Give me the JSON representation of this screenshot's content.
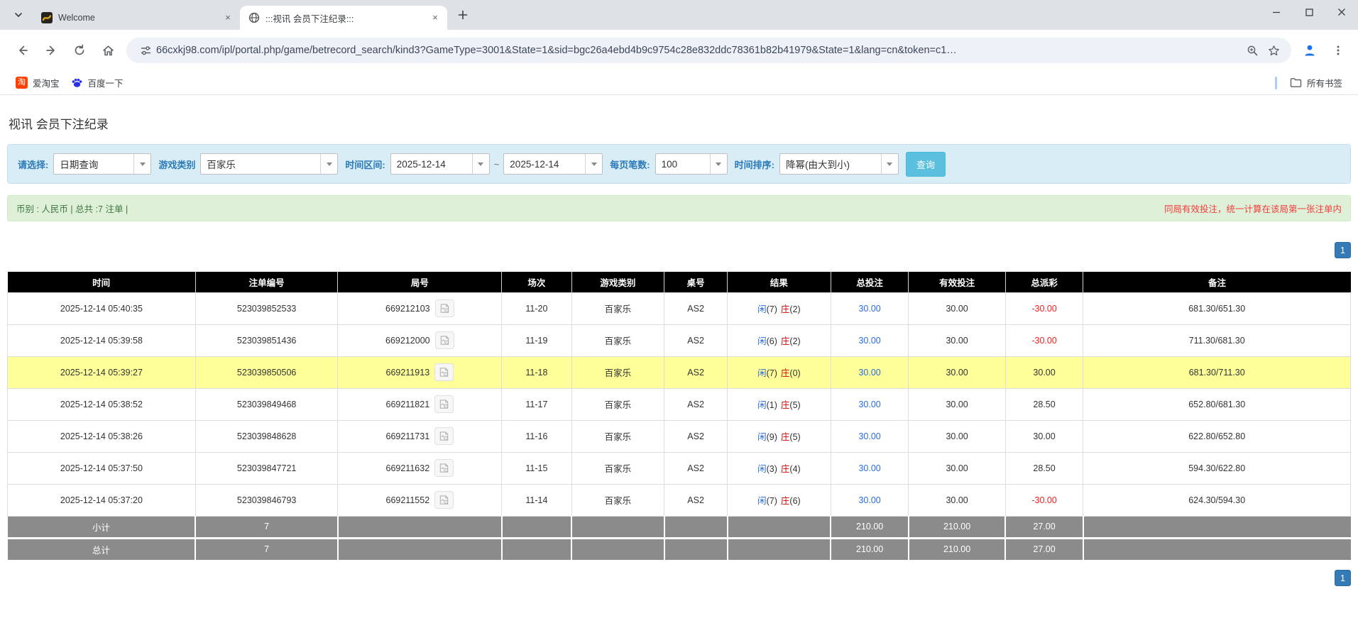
{
  "browser": {
    "tabs": [
      {
        "title": "Welcome"
      },
      {
        "title": ":::视讯 会员下注纪录:::"
      }
    ],
    "icons": {
      "tab_close_glyph": "×",
      "taobao_glyph": "淘"
    },
    "url": "66cxkj98.com/ipl/portal.php/game/betrecord_search/kind3?GameType=3001&State=1&sid=bgc26a4ebd4b9c9754c28e832ddc78361b82b41979&State=1&lang=cn&token=c1…",
    "bookmarks": [
      {
        "label": "爱淘宝"
      },
      {
        "label": "百度一下"
      }
    ],
    "all_bookmarks_label": "所有书签"
  },
  "page": {
    "title": "视讯 会员下注纪录",
    "filters": {
      "select_label": "请选择:",
      "select_value": "日期查询",
      "game_type_label": "游戏类别",
      "game_type_value": "百家乐",
      "time_range_label": "时间区间:",
      "date_from": "2025-12-14",
      "tilde": "~",
      "date_to": "2025-12-14",
      "page_size_label": "每页笔数:",
      "page_size_value": "100",
      "sort_label": "时间排序:",
      "sort_value": "降幂(由大到小)",
      "search_button": "查询"
    },
    "info_bar": {
      "left": "币别 : 人民币 | 总共 :7 注单 |",
      "right": "同局有效投注，统一计算在该局第一张注单内"
    },
    "pagination": "1",
    "colors": {
      "highlight_row": "#feff99",
      "header_bg": "#000000",
      "footer_bg": "#8b8b8b",
      "value_blue": "#2a6ce0",
      "negative_red": "#f02020",
      "banker_red": "#cc0000",
      "pagination_blue": "#337ab7",
      "query_button_blue": "#5bc0de"
    },
    "table": {
      "headers": [
        "时间",
        "注单编号",
        "局号",
        "场次",
        "游戏类别",
        "桌号",
        "结果",
        "总投注",
        "有效投注",
        "总派彩",
        "备注"
      ],
      "rows": [
        {
          "time": "2025-12-14 05:40:35",
          "bet_id": "523039852533",
          "round_id": "669212103",
          "session": "11-20",
          "game": "百家乐",
          "table_no": "AS2",
          "p": "闲",
          "pv": "(7)",
          "b": "庄",
          "bv": "(2)",
          "total_bet": "30.00",
          "valid_bet": "30.00",
          "payout": "-30.00",
          "payout_negative": true,
          "remark": "681.30/651.30",
          "highlight": false
        },
        {
          "time": "2025-12-14 05:39:58",
          "bet_id": "523039851436",
          "round_id": "669212000",
          "session": "11-19",
          "game": "百家乐",
          "table_no": "AS2",
          "p": "闲",
          "pv": "(6)",
          "b": "庄",
          "bv": "(2)",
          "total_bet": "30.00",
          "valid_bet": "30.00",
          "payout": "-30.00",
          "payout_negative": true,
          "remark": "711.30/681.30",
          "highlight": false
        },
        {
          "time": "2025-12-14 05:39:27",
          "bet_id": "523039850506",
          "round_id": "669211913",
          "session": "11-18",
          "game": "百家乐",
          "table_no": "AS2",
          "p": "闲",
          "pv": "(7)",
          "b": "庄",
          "bv": "(0)",
          "total_bet": "30.00",
          "valid_bet": "30.00",
          "payout": "30.00",
          "payout_negative": false,
          "remark": "681.30/711.30",
          "highlight": true
        },
        {
          "time": "2025-12-14 05:38:52",
          "bet_id": "523039849468",
          "round_id": "669211821",
          "session": "11-17",
          "game": "百家乐",
          "table_no": "AS2",
          "p": "闲",
          "pv": "(1)",
          "b": "庄",
          "bv": "(5)",
          "total_bet": "30.00",
          "valid_bet": "30.00",
          "payout": "28.50",
          "payout_negative": false,
          "remark": "652.80/681.30",
          "highlight": false
        },
        {
          "time": "2025-12-14 05:38:26",
          "bet_id": "523039848628",
          "round_id": "669211731",
          "session": "11-16",
          "game": "百家乐",
          "table_no": "AS2",
          "p": "闲",
          "pv": "(9)",
          "b": "庄",
          "bv": "(5)",
          "total_bet": "30.00",
          "valid_bet": "30.00",
          "payout": "30.00",
          "payout_negative": false,
          "remark": "622.80/652.80",
          "highlight": false
        },
        {
          "time": "2025-12-14 05:37:50",
          "bet_id": "523039847721",
          "round_id": "669211632",
          "session": "11-15",
          "game": "百家乐",
          "table_no": "AS2",
          "p": "闲",
          "pv": "(3)",
          "b": "庄",
          "bv": "(4)",
          "total_bet": "30.00",
          "valid_bet": "30.00",
          "payout": "28.50",
          "payout_negative": false,
          "remark": "594.30/622.80",
          "highlight": false
        },
        {
          "time": "2025-12-14 05:37:20",
          "bet_id": "523039846793",
          "round_id": "669211552",
          "session": "11-14",
          "game": "百家乐",
          "table_no": "AS2",
          "p": "闲",
          "pv": "(7)",
          "b": "庄",
          "bv": "(6)",
          "total_bet": "30.00",
          "valid_bet": "30.00",
          "payout": "-30.00",
          "payout_negative": true,
          "remark": "624.30/594.30",
          "highlight": false
        }
      ],
      "subtotal": {
        "label": "小计",
        "count": "7",
        "total_bet": "210.00",
        "valid_bet": "210.00",
        "payout": "27.00"
      },
      "total": {
        "label": "总计",
        "count": "7",
        "total_bet": "210.00",
        "valid_bet": "210.00",
        "payout": "27.00"
      }
    }
  }
}
